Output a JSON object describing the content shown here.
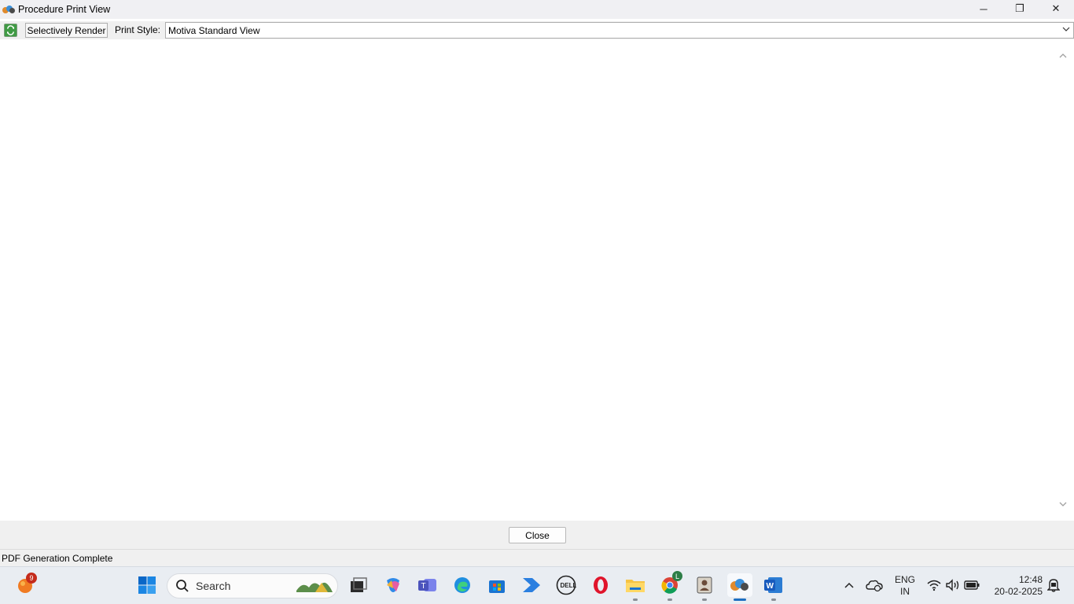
{
  "window": {
    "title": "Procedure Print View",
    "controls": {
      "minimize": "─",
      "restore": "❐",
      "close": "✕"
    }
  },
  "toolbar": {
    "refresh_icon": "refresh-icon",
    "selectively_render_label": "Selectively Render",
    "print_style_label": "Print Style:",
    "print_style_value": "Motiva Standard View"
  },
  "footer": {
    "close_label": "Close"
  },
  "status": {
    "text": "PDF Generation Complete"
  },
  "taskbar": {
    "notification_badge": "9",
    "search_label": "Search",
    "chrome_badge": "L",
    "language": "ENG",
    "region": "IN",
    "time": "12:48",
    "date": "20-02-2025"
  },
  "colors": {
    "accent": "#1d6fc1",
    "refresh_green": "#3f9b44"
  }
}
